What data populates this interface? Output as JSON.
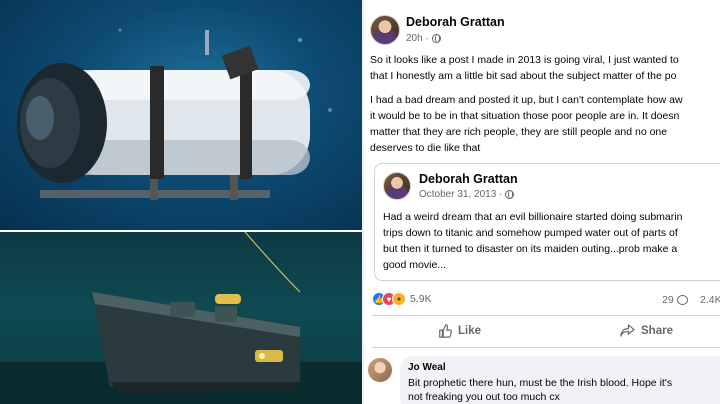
{
  "post": {
    "author": "Deborah Grattan",
    "time": "20h ·",
    "body_lines": [
      "So it looks like a post I made in 2013 is going viral, I just wanted to",
      "that I honestly am a little bit sad about the subject matter of the po",
      "I had a bad dream and posted it up, but I can't contemplate how aw",
      "it would be to be in that situation those poor people are in. It doesn",
      "matter that they are rich people, they are still people and no one",
      "deserves to die like that"
    ]
  },
  "shared_post": {
    "author": "Deborah Grattan",
    "time": "October 31, 2013 ·",
    "body_lines": [
      "Had a weird dream that an evil billionaire started doing submarin",
      "trips down to titanic and somehow pumped water out of parts of",
      "but then it turned to disaster on its maiden outing...prob make a",
      "good movie..."
    ]
  },
  "stats": {
    "reactions_count": "5.9K",
    "comments_count": "29",
    "shares_count": "2.4K"
  },
  "actions": {
    "like_label": "Like",
    "share_label": "Share"
  },
  "comment": {
    "author": "Jo Weal",
    "lines": [
      "Bit prophetic there hun, must be the Irish blood. Hope it's",
      "not freaking you out too much cx"
    ]
  },
  "colors": {
    "facebook_blue": "#1877f2",
    "meta_gray": "#65676b",
    "comment_bg": "#f0f2f5"
  },
  "icons": [
    "globe-icon",
    "more-icon",
    "like-reaction-icon",
    "love-reaction-icon",
    "wow-reaction-icon",
    "comment-icon",
    "share-icon",
    "thumb-up-icon"
  ]
}
